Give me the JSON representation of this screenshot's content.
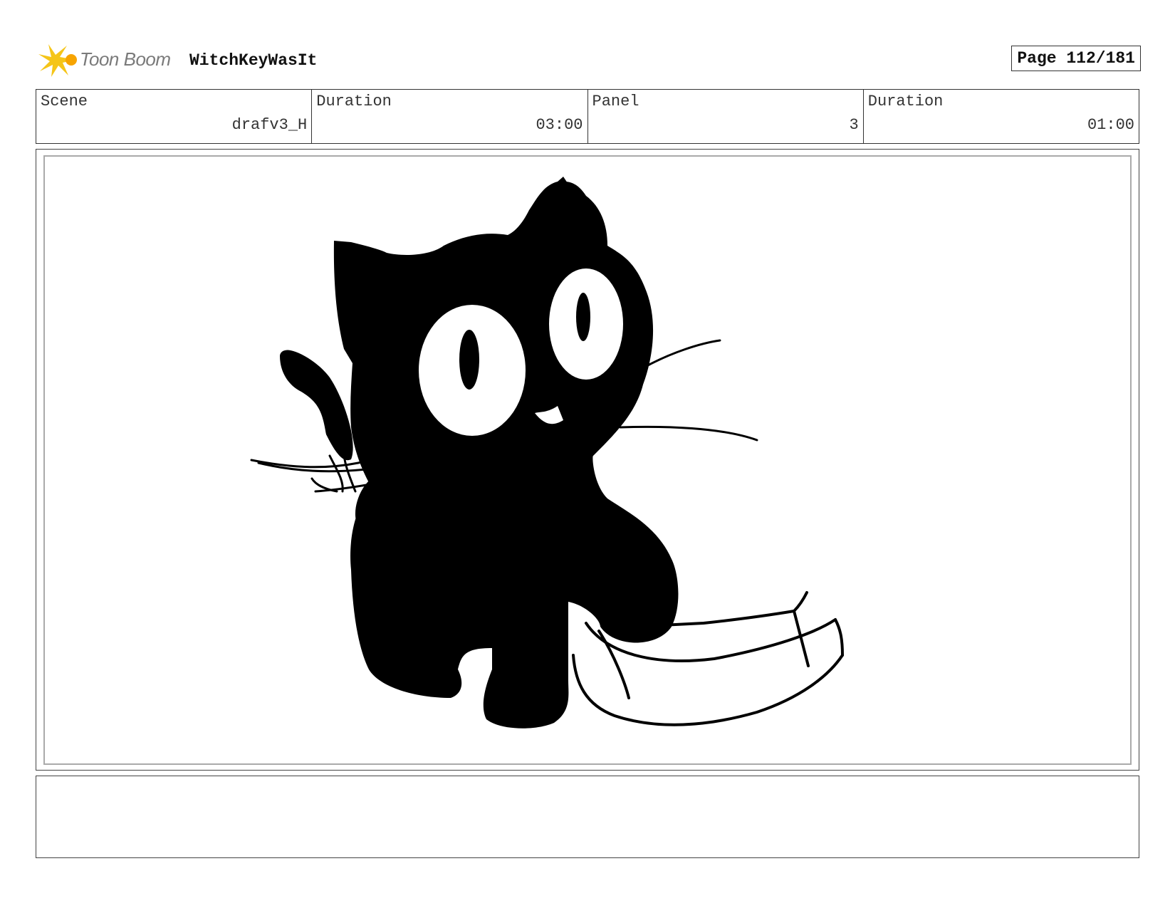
{
  "header": {
    "logo_text": "Toon Boom",
    "project_title": "WitchKeyWasIt",
    "page_indicator": "Page 112/181"
  },
  "info": {
    "scene_label": "Scene",
    "scene_value": "drafv3_H",
    "scene_duration_label": "Duration",
    "scene_duration_value": "03:00",
    "panel_label": "Panel",
    "panel_value": "3",
    "panel_duration_label": "Duration",
    "panel_duration_value": "01:00"
  },
  "panel": {
    "image_icon": "black-cat-sketch"
  },
  "notes": {
    "text": ""
  },
  "colors": {
    "logo_star": "#f5c518",
    "border": "#333333",
    "inner_border": "#aaaaaa"
  }
}
